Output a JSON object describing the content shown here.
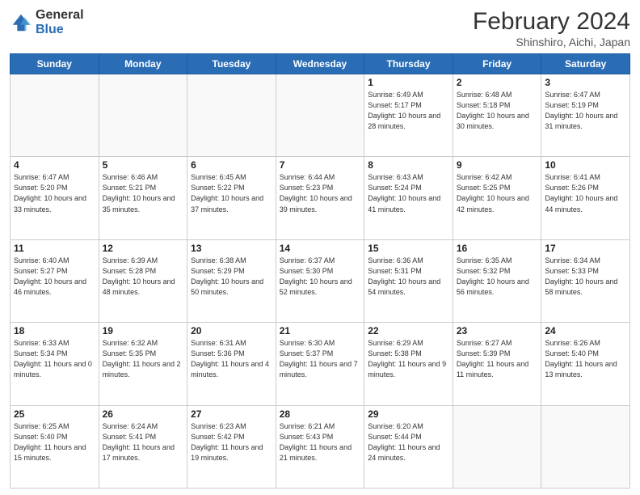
{
  "header": {
    "logo_general": "General",
    "logo_blue": "Blue",
    "title": "February 2024",
    "subtitle": "Shinshiro, Aichi, Japan"
  },
  "days_of_week": [
    "Sunday",
    "Monday",
    "Tuesday",
    "Wednesday",
    "Thursday",
    "Friday",
    "Saturday"
  ],
  "weeks": [
    [
      {
        "day": "",
        "info": ""
      },
      {
        "day": "",
        "info": ""
      },
      {
        "day": "",
        "info": ""
      },
      {
        "day": "",
        "info": ""
      },
      {
        "day": "1",
        "info": "Sunrise: 6:49 AM\nSunset: 5:17 PM\nDaylight: 10 hours\nand 28 minutes."
      },
      {
        "day": "2",
        "info": "Sunrise: 6:48 AM\nSunset: 5:18 PM\nDaylight: 10 hours\nand 30 minutes."
      },
      {
        "day": "3",
        "info": "Sunrise: 6:47 AM\nSunset: 5:19 PM\nDaylight: 10 hours\nand 31 minutes."
      }
    ],
    [
      {
        "day": "4",
        "info": "Sunrise: 6:47 AM\nSunset: 5:20 PM\nDaylight: 10 hours\nand 33 minutes."
      },
      {
        "day": "5",
        "info": "Sunrise: 6:46 AM\nSunset: 5:21 PM\nDaylight: 10 hours\nand 35 minutes."
      },
      {
        "day": "6",
        "info": "Sunrise: 6:45 AM\nSunset: 5:22 PM\nDaylight: 10 hours\nand 37 minutes."
      },
      {
        "day": "7",
        "info": "Sunrise: 6:44 AM\nSunset: 5:23 PM\nDaylight: 10 hours\nand 39 minutes."
      },
      {
        "day": "8",
        "info": "Sunrise: 6:43 AM\nSunset: 5:24 PM\nDaylight: 10 hours\nand 41 minutes."
      },
      {
        "day": "9",
        "info": "Sunrise: 6:42 AM\nSunset: 5:25 PM\nDaylight: 10 hours\nand 42 minutes."
      },
      {
        "day": "10",
        "info": "Sunrise: 6:41 AM\nSunset: 5:26 PM\nDaylight: 10 hours\nand 44 minutes."
      }
    ],
    [
      {
        "day": "11",
        "info": "Sunrise: 6:40 AM\nSunset: 5:27 PM\nDaylight: 10 hours\nand 46 minutes."
      },
      {
        "day": "12",
        "info": "Sunrise: 6:39 AM\nSunset: 5:28 PM\nDaylight: 10 hours\nand 48 minutes."
      },
      {
        "day": "13",
        "info": "Sunrise: 6:38 AM\nSunset: 5:29 PM\nDaylight: 10 hours\nand 50 minutes."
      },
      {
        "day": "14",
        "info": "Sunrise: 6:37 AM\nSunset: 5:30 PM\nDaylight: 10 hours\nand 52 minutes."
      },
      {
        "day": "15",
        "info": "Sunrise: 6:36 AM\nSunset: 5:31 PM\nDaylight: 10 hours\nand 54 minutes."
      },
      {
        "day": "16",
        "info": "Sunrise: 6:35 AM\nSunset: 5:32 PM\nDaylight: 10 hours\nand 56 minutes."
      },
      {
        "day": "17",
        "info": "Sunrise: 6:34 AM\nSunset: 5:33 PM\nDaylight: 10 hours\nand 58 minutes."
      }
    ],
    [
      {
        "day": "18",
        "info": "Sunrise: 6:33 AM\nSunset: 5:34 PM\nDaylight: 11 hours\nand 0 minutes."
      },
      {
        "day": "19",
        "info": "Sunrise: 6:32 AM\nSunset: 5:35 PM\nDaylight: 11 hours\nand 2 minutes."
      },
      {
        "day": "20",
        "info": "Sunrise: 6:31 AM\nSunset: 5:36 PM\nDaylight: 11 hours\nand 4 minutes."
      },
      {
        "day": "21",
        "info": "Sunrise: 6:30 AM\nSunset: 5:37 PM\nDaylight: 11 hours\nand 7 minutes."
      },
      {
        "day": "22",
        "info": "Sunrise: 6:29 AM\nSunset: 5:38 PM\nDaylight: 11 hours\nand 9 minutes."
      },
      {
        "day": "23",
        "info": "Sunrise: 6:27 AM\nSunset: 5:39 PM\nDaylight: 11 hours\nand 11 minutes."
      },
      {
        "day": "24",
        "info": "Sunrise: 6:26 AM\nSunset: 5:40 PM\nDaylight: 11 hours\nand 13 minutes."
      }
    ],
    [
      {
        "day": "25",
        "info": "Sunrise: 6:25 AM\nSunset: 5:40 PM\nDaylight: 11 hours\nand 15 minutes."
      },
      {
        "day": "26",
        "info": "Sunrise: 6:24 AM\nSunset: 5:41 PM\nDaylight: 11 hours\nand 17 minutes."
      },
      {
        "day": "27",
        "info": "Sunrise: 6:23 AM\nSunset: 5:42 PM\nDaylight: 11 hours\nand 19 minutes."
      },
      {
        "day": "28",
        "info": "Sunrise: 6:21 AM\nSunset: 5:43 PM\nDaylight: 11 hours\nand 21 minutes."
      },
      {
        "day": "29",
        "info": "Sunrise: 6:20 AM\nSunset: 5:44 PM\nDaylight: 11 hours\nand 24 minutes."
      },
      {
        "day": "",
        "info": ""
      },
      {
        "day": "",
        "info": ""
      }
    ]
  ]
}
